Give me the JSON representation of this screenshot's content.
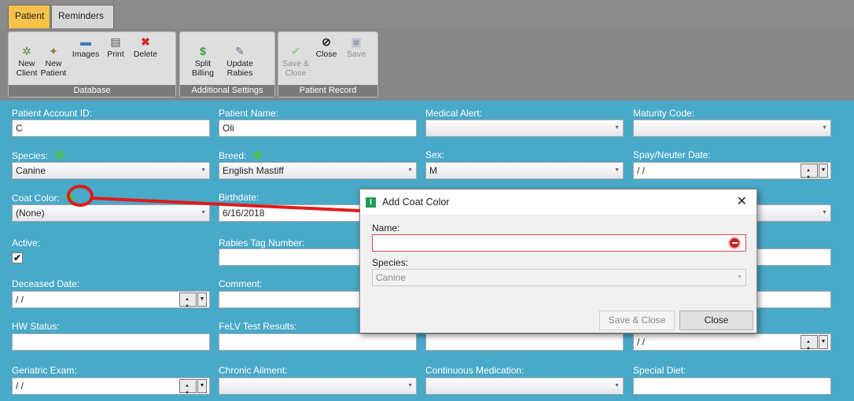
{
  "tabs": {
    "patient": "Patient",
    "reminders": "Reminders"
  },
  "ribbon": {
    "database": {
      "label": "Database",
      "new_client": "New\nClient",
      "new_patient": "New\nPatient",
      "images": "Images",
      "print": "Print",
      "delete": "Delete"
    },
    "additional": {
      "label": "Additional Settings",
      "split_billing": "Split\nBilling",
      "update_rabies": "Update\nRabies"
    },
    "record": {
      "label": "Patient Record",
      "save_close": "Save &\nClose",
      "close": "Close",
      "save": "Save"
    }
  },
  "form": {
    "patient_account_id": {
      "label": "Patient Account ID:",
      "value": "C"
    },
    "patient_name": {
      "label": "Patient Name:",
      "value": "Oli"
    },
    "medical_alert": {
      "label": "Medical Alert:",
      "value": ""
    },
    "maturity_code": {
      "label": "Maturity Code:",
      "value": ""
    },
    "species": {
      "label": "Species:",
      "value": "Canine"
    },
    "breed": {
      "label": "Breed:",
      "value": "English Mastiff"
    },
    "sex": {
      "label": "Sex:",
      "value": "M"
    },
    "spay_neuter_date": {
      "label": "Spay/Neuter Date:",
      "value": " /  /"
    },
    "coat_color": {
      "label": "Coat Color:",
      "value": "(None)"
    },
    "birthdate": {
      "label": "Birthdate:",
      "value": "6/16/2018"
    },
    "active": {
      "label": "Active:",
      "checked": "✔"
    },
    "rabies_tag": {
      "label": "Rabies Tag Number:",
      "value": ""
    },
    "deceased_date": {
      "label": "Deceased Date:",
      "value": " /  /"
    },
    "comment": {
      "label": "Comment:",
      "value": ""
    },
    "hw_status": {
      "label": "HW Status:",
      "value": ""
    },
    "felv_test": {
      "label": "FeLV Test Results:",
      "value": ""
    },
    "col4_row5_date": {
      "value": " /  /"
    },
    "geriatric_exam": {
      "label": "Geriatric Exam:",
      "value": " /  /"
    },
    "chronic_ailment": {
      "label": "Chronic Ailment:",
      "value": ""
    },
    "continuous_medication": {
      "label": "Continuous Medication:",
      "value": ""
    },
    "special_diet": {
      "label": "Special Diet:",
      "value": ""
    }
  },
  "dialog": {
    "title": "Add Coat Color",
    "name_label": "Name:",
    "name_value": "",
    "species_label": "Species:",
    "species_value": "Canine",
    "save_close": "Save & Close",
    "close": "Close"
  },
  "colors": {
    "tab_active": "#f6c24a",
    "main_bg": "#49a9c8",
    "annotation": "#e01b1b",
    "plus_green": "#4cc24c"
  }
}
